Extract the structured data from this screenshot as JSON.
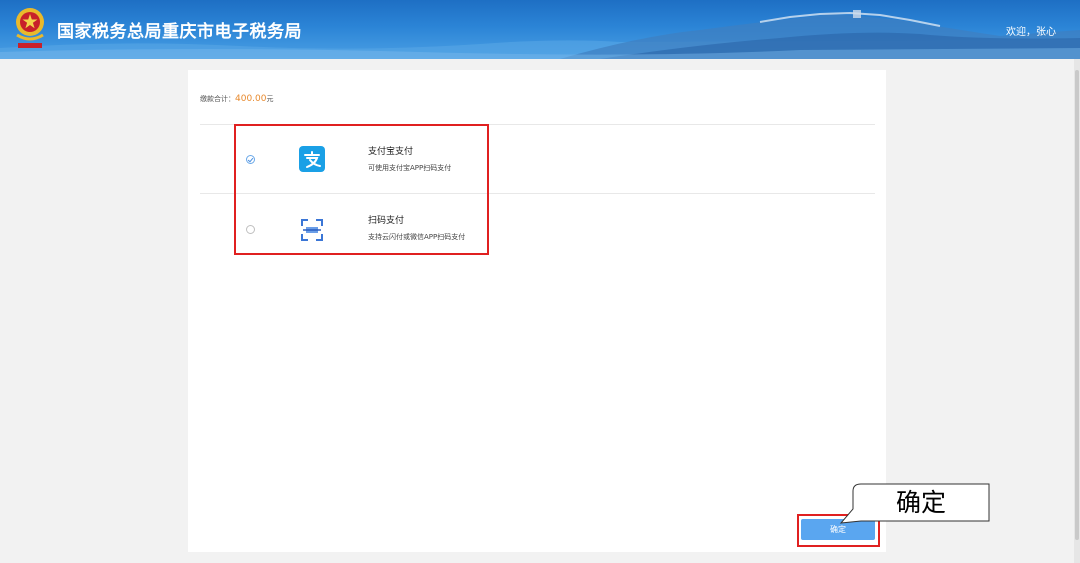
{
  "header": {
    "site_title": "国家税务总局重庆市电子税务局",
    "welcome_text": "欢迎，张心",
    "bg_color": "#2b84d6"
  },
  "payment": {
    "total_label": "缴款合计：",
    "total_amount": "400.00",
    "total_unit": "元",
    "options": [
      {
        "name": "支付宝支付",
        "desc": "可使用支付宝APP扫码支付",
        "icon": "alipay-icon",
        "selected": true
      },
      {
        "name": "扫码支付",
        "desc": "支持云闪付或微信APP扫码支付",
        "icon": "scan-code-icon",
        "selected": false
      }
    ]
  },
  "actions": {
    "confirm_label": "确定"
  },
  "annotation": {
    "callout_text": "确定"
  },
  "colors": {
    "accent": "#5aa6f0",
    "amount": "#e88a2e",
    "highlight": "#e02020"
  }
}
